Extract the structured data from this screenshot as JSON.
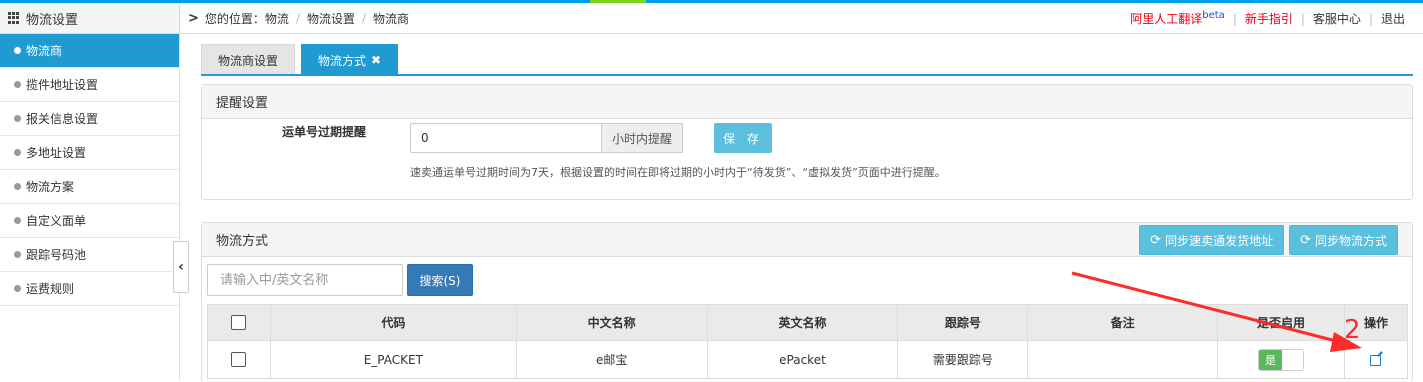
{
  "sidebar": {
    "title": "物流设置",
    "items": [
      {
        "label": "物流商",
        "active": true
      },
      {
        "label": "揽件地址设置"
      },
      {
        "label": "报关信息设置"
      },
      {
        "label": "多地址设置"
      },
      {
        "label": "物流方案"
      },
      {
        "label": "自定义面单"
      },
      {
        "label": "跟踪号码池"
      },
      {
        "label": "运费规则"
      }
    ],
    "collapse_icon": "chevron-left-icon"
  },
  "breadcrumb": {
    "prefix": "您的位置：",
    "items": [
      "物流",
      "物流设置",
      "物流商"
    ],
    "separator": "/"
  },
  "toplinks": {
    "translate": "阿里人工翻译",
    "translate_badge": "beta",
    "guide": "新手指引",
    "service": "客服中心",
    "logout": "退出"
  },
  "tabs": [
    {
      "label": "物流商设置",
      "active": false
    },
    {
      "label": "物流方式",
      "active": true,
      "close": "✖"
    }
  ],
  "reminder": {
    "title": "提醒设置",
    "label": "运单号过期提醒",
    "value": "0",
    "addon": "小时内提醒",
    "save_label": "保 存",
    "hint": "速卖通运单号过期时间为7天，根据设置的时间在即将过期的小时内于“待发货”、“虚拟发货”页面中进行提醒。"
  },
  "methods": {
    "title": "物流方式",
    "sync_address_label": "同步速卖通发货地址",
    "sync_methods_label": "同步物流方式",
    "search_placeholder": "请输入中/英文名称",
    "search_label": "搜索(S)",
    "columns": [
      "代码",
      "中文名称",
      "英文名称",
      "跟踪号",
      "备注",
      "是否启用",
      "操作"
    ],
    "rows": [
      {
        "code": "E_PACKET",
        "cn_name": "e邮宝",
        "en_name": "ePacket",
        "tracking": "需要跟踪号",
        "note": "",
        "enabled": "是"
      }
    ]
  },
  "annotation": {
    "label": "2",
    "color": "#ff2a2a"
  },
  "colors": {
    "accent": "#1f9bd1",
    "info": "#5bc0de",
    "primary": "#337ab7",
    "success": "#5cb85c"
  }
}
